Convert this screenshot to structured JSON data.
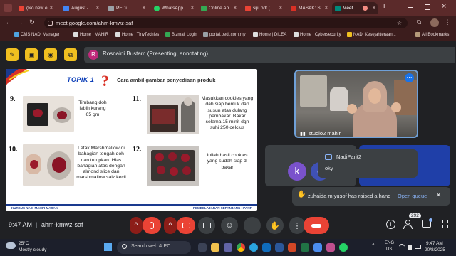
{
  "browser": {
    "tabs": [
      {
        "label": "(No new e",
        "color": "#ea4335"
      },
      {
        "label": "August -",
        "color": "#4285f4"
      },
      {
        "label": "PEDi",
        "color": "#9aa0a6"
      },
      {
        "label": "WhatsApp",
        "color": "#25d366"
      },
      {
        "label": "Online Ap",
        "color": "#34a853"
      },
      {
        "label": "sijil.pdf (",
        "color": "#ea4335"
      },
      {
        "label": "MASAK: S",
        "color": "#d93025"
      },
      {
        "label": "Meet",
        "color": "#00897b"
      }
    ],
    "new_tab": "+",
    "url": "meet.google.com/ahm-kmwz-saf",
    "bookmarks": [
      {
        "label": "CMS NADI Manager"
      },
      {
        "label": "Home | MAHIR"
      },
      {
        "label": "Home | TinyTechies"
      },
      {
        "label": "Bizmall Login"
      },
      {
        "label": "portal.pedi.com.my"
      },
      {
        "label": "Home | DILEA"
      },
      {
        "label": "Home | Cybersecurity"
      },
      {
        "label": "NADI Kesejahteraan..."
      }
    ],
    "all_bookmarks": "All Bookmarks"
  },
  "meet": {
    "presenter_initial": "R",
    "presenter_label": "Rosnaini Bustam (Presenting, annotating)",
    "slide": {
      "topic": "TOPIK 1",
      "title": "Cara ambil gambar penyediaan produk",
      "steps": [
        {
          "num": "9.",
          "text": "Timbang doh lebih kurang 65 gm"
        },
        {
          "num": "11.",
          "text": "Masukkan cookies yang dah siap bentuk dan susun atas dulang pembakar.  Bakar selama 15 minit dgn suhi 250 celcius"
        },
        {
          "num": "10.",
          "text": "Letak Marshmallow di bahagian tengah doh dan tutupkan. Hias bahagian atas dengan almond slice dan marshmallow saiz kecil"
        },
        {
          "num": "12.",
          "text": "Inilah hasil cookies yang sudah siap di bakar"
        }
      ],
      "footer_left": "KURSUS NADI MAHIR MASAK",
      "footer_right": "PEMBELAJARAN SEPANJANG HAYAT"
    },
    "tiles": {
      "studio_name": "studio2 mahir",
      "k_initial": "k",
      "e_initial": "e"
    },
    "chat_notification": {
      "sender": "NadiParit2",
      "message": "oky"
    },
    "hand_notification": {
      "text": "zuhaida m yusof has raised a hand",
      "action": "Open queue"
    },
    "meeting_time": "9:47 AM",
    "meeting_code": "ahm-kmwz-saf",
    "participant_count": "292"
  },
  "taskbar": {
    "temperature": "25°C",
    "weather": "Mostly cloudy",
    "search_placeholder": "Search web & PC",
    "lang": "ENG",
    "region": "US",
    "clock_time": "9:47 AM",
    "clock_date": "20/8/2025"
  },
  "colors": {
    "tab_strip": "#5b2a2a",
    "toolbar": "#3c1d1d",
    "meet_bg": "#202124",
    "accent_yellow": "#f0c020",
    "end_call": "#ea4335",
    "slide_blue": "#1a3a8f"
  }
}
